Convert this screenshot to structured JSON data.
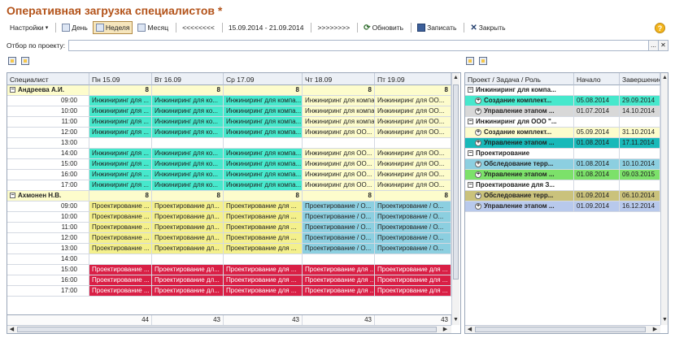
{
  "title": "Оперативная загрузка специалистов *",
  "toolbar": {
    "settings": "Настройки",
    "day": "День",
    "week": "Неделя",
    "month": "Месяц",
    "prev": "<<<<<<<<",
    "period": "15.09.2014 - 21.09.2014",
    "next": ">>>>>>>>",
    "refresh": "Обновить",
    "save": "Записать",
    "close": "Закрыть"
  },
  "filter": {
    "label": "Отбор по проекту:",
    "value": ""
  },
  "grid": {
    "headers": [
      "Специалист",
      "Пн 15.09",
      "Вт 16.09",
      "Ср 17.09",
      "Чт 18.09",
      "Пт 19.09"
    ],
    "people": [
      {
        "name": "Андреева А.И.",
        "day_totals": [
          "8",
          "8",
          "8",
          "8",
          "8"
        ],
        "slots": [
          {
            "time": "09:00",
            "cells": [
              "Инжиниринг для ...",
              "Инжиниринг для ко...",
              "Инжиниринг для компа...",
              "Инжиниринг для компа...",
              "Инжиниринг для ОО..."
            ],
            "kinds": [
              "t",
              "t",
              "t",
              "y",
              "y"
            ]
          },
          {
            "time": "10:00",
            "cells": [
              "Инжиниринг для ...",
              "Инжиниринг для ко...",
              "Инжиниринг для компа...",
              "Инжиниринг для компа...",
              "Инжиниринг для ОО..."
            ],
            "kinds": [
              "t",
              "t",
              "t",
              "y",
              "y"
            ]
          },
          {
            "time": "11:00",
            "cells": [
              "Инжиниринг для ...",
              "Инжиниринг для ко...",
              "Инжиниринг для компа...",
              "Инжиниринг для компа...",
              "Инжиниринг для ОО..."
            ],
            "kinds": [
              "t",
              "t",
              "t",
              "y",
              "y"
            ]
          },
          {
            "time": "12:00",
            "cells": [
              "Инжиниринг для ...",
              "Инжиниринг для ко...",
              "Инжиниринг для компа...",
              "Инжиниринг для ОО...",
              "Инжиниринг для ОО..."
            ],
            "kinds": [
              "t",
              "t",
              "t",
              "y",
              "y"
            ]
          },
          {
            "time": "13:00",
            "cells": [
              "",
              "",
              "",
              "",
              ""
            ],
            "kinds": [
              "e",
              "e",
              "e",
              "e",
              "e"
            ]
          },
          {
            "time": "14:00",
            "cells": [
              "Инжиниринг для ...",
              "Инжиниринг для ко...",
              "Инжиниринг для компа...",
              "Инжиниринг для ОО...",
              "Инжиниринг для ОО..."
            ],
            "kinds": [
              "t",
              "t",
              "t",
              "y",
              "y"
            ]
          },
          {
            "time": "15:00",
            "cells": [
              "Инжиниринг для ...",
              "Инжиниринг для ко...",
              "Инжиниринг для компа...",
              "Инжиниринг для ОО...",
              "Инжиниринг для ОО..."
            ],
            "kinds": [
              "t",
              "t",
              "t",
              "y",
              "y"
            ]
          },
          {
            "time": "16:00",
            "cells": [
              "Инжиниринг для ...",
              "Инжиниринг для ко...",
              "Инжиниринг для компа...",
              "Инжиниринг для ОО...",
              "Инжиниринг для ОО..."
            ],
            "kinds": [
              "t",
              "t",
              "t",
              "y",
              "y"
            ]
          },
          {
            "time": "17:00",
            "cells": [
              "Инжиниринг для ...",
              "Инжиниринг для ко...",
              "Инжиниринг для компа...",
              "Инжиниринг для ОО...",
              "Инжиниринг для ОО..."
            ],
            "kinds": [
              "t",
              "t",
              "t",
              "y",
              "y"
            ]
          }
        ]
      },
      {
        "name": "Ахмонен Н.В.",
        "day_totals": [
          "8",
          "8",
          "8",
          "8",
          "8"
        ],
        "slots": [
          {
            "time": "09:00",
            "cells": [
              "Проектирование ...",
              "Проектирование дл...",
              "Проектирование для ...",
              "Проектирование / О...",
              "Проектирование / О..."
            ],
            "kinds": [
              "o",
              "o",
              "o",
              "b",
              "b"
            ]
          },
          {
            "time": "10:00",
            "cells": [
              "Проектирование ...",
              "Проектирование дл...",
              "Проектирование для ...",
              "Проектирование / О...",
              "Проектирование / О..."
            ],
            "kinds": [
              "o",
              "o",
              "o",
              "b",
              "b"
            ]
          },
          {
            "time": "11:00",
            "cells": [
              "Проектирование ...",
              "Проектирование дл...",
              "Проектирование для ...",
              "Проектирование / О...",
              "Проектирование / О..."
            ],
            "kinds": [
              "o",
              "o",
              "o",
              "b",
              "b"
            ]
          },
          {
            "time": "12:00",
            "cells": [
              "Проектирование ...",
              "Проектирование дл...",
              "Проектирование для ...",
              "Проектирование / О...",
              "Проектирование / О..."
            ],
            "kinds": [
              "o",
              "o",
              "o",
              "b",
              "b"
            ]
          },
          {
            "time": "13:00",
            "cells": [
              "Проектирование ...",
              "Проектирование дл...",
              "Проектирование для ...",
              "Проектирование / О...",
              "Проектирование / О..."
            ],
            "kinds": [
              "o",
              "o",
              "o",
              "b",
              "b"
            ]
          },
          {
            "time": "14:00",
            "cells": [
              "",
              "",
              "",
              "",
              ""
            ],
            "kinds": [
              "e",
              "e",
              "e",
              "e",
              "e"
            ]
          },
          {
            "time": "15:00",
            "cells": [
              "Проектирование ...",
              "Проектирование дл...",
              "Проектирование для ...",
              "Проектирование для ...",
              "Проектирование для ..."
            ],
            "kinds": [
              "r",
              "r",
              "r",
              "r",
              "r"
            ]
          },
          {
            "time": "16:00",
            "cells": [
              "Проектирование ...",
              "Проектирование дл...",
              "Проектирование для ...",
              "Проектирование для ...",
              "Проектирование для ..."
            ],
            "kinds": [
              "r",
              "r",
              "r",
              "r",
              "r"
            ]
          },
          {
            "time": "17:00",
            "cells": [
              "Проектирование ...",
              "Проектирование дл...",
              "Проектирование для ...",
              "Проектирование для ...",
              "Проектирование для ..."
            ],
            "kinds": [
              "r",
              "r",
              "r",
              "r",
              "r"
            ]
          }
        ]
      }
    ],
    "totals": [
      "44",
      "43",
      "43",
      "43",
      "43"
    ]
  },
  "right": {
    "headers": [
      "Проект / Задача / Роль",
      "Начало",
      "Завершение"
    ],
    "rows": [
      {
        "label": "Инжиниринг для компа...",
        "start": "",
        "end": "",
        "level": 0,
        "kind": "e"
      },
      {
        "label": "Создание комплект...",
        "start": "05.08.2014",
        "end": "29.09.2014",
        "level": 1,
        "kind": "t"
      },
      {
        "label": "Управление этапом ...",
        "start": "01.07.2014",
        "end": "14.10.2014",
        "level": 1,
        "kind": "g"
      },
      {
        "label": "Инжиниринг для ООО \"...",
        "start": "",
        "end": "",
        "level": 0,
        "kind": "e"
      },
      {
        "label": "Создание комплект...",
        "start": "05.09.2014",
        "end": "31.10.2014",
        "level": 1,
        "kind": "y"
      },
      {
        "label": "Управление этапом ...",
        "start": "01.08.2014",
        "end": "17.11.2014",
        "level": 1,
        "kind": "d"
      },
      {
        "label": "Проектирование",
        "start": "",
        "end": "",
        "level": 0,
        "kind": "e"
      },
      {
        "label": "Обследование терр...",
        "start": "01.08.2014",
        "end": "10.10.2014",
        "level": 1,
        "kind": "b"
      },
      {
        "label": "Управление этапом ...",
        "start": "01.08.2014",
        "end": "09.03.2015",
        "level": 1,
        "kind": "l"
      },
      {
        "label": "Проектирование для З...",
        "start": "",
        "end": "",
        "level": 0,
        "kind": "e"
      },
      {
        "label": "Обследование терр...",
        "start": "01.09.2014",
        "end": "06.10.2014",
        "level": 1,
        "kind": "k"
      },
      {
        "label": "Управление этапом ...",
        "start": "01.09.2014",
        "end": "16.12.2014",
        "level": 1,
        "kind": "p"
      }
    ]
  },
  "colors": {
    "t": "#46e8cc",
    "y": "#fdfccc",
    "o": "#f4f08c",
    "b": "#8ccfe0",
    "r": "#d91f45",
    "e": "#ffffff",
    "g": "#d8d8d8",
    "d": "#18b9b9",
    "l": "#7ce16a",
    "k": "#cac27c",
    "p": "#b8c9ec",
    "person": "#fdfccc",
    "accent": "#b3531a"
  }
}
